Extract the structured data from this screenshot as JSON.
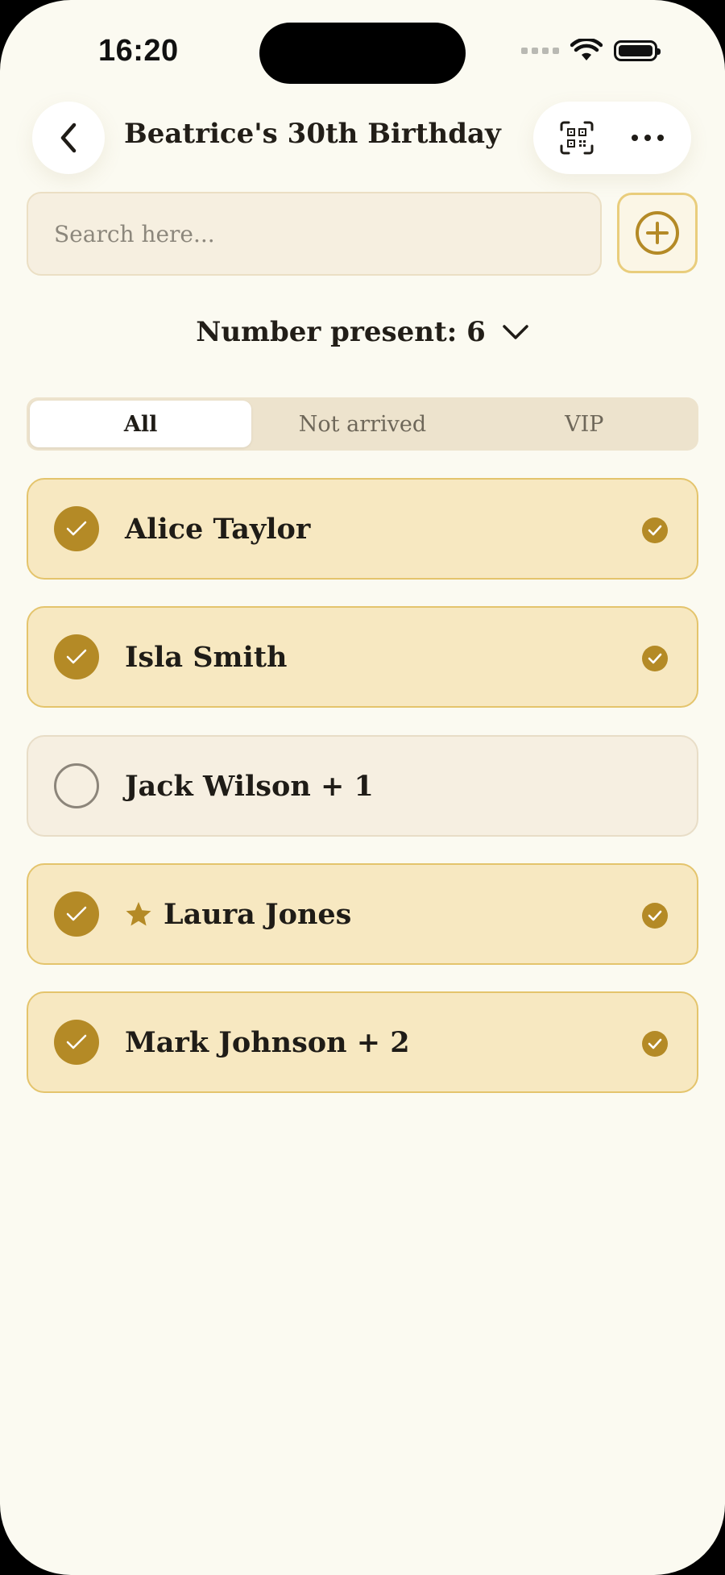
{
  "status_bar": {
    "time": "16:20"
  },
  "header": {
    "title": "Beatrice's 30th Birthday",
    "back_icon": "chevron-left-icon",
    "qr_icon": "qr-scan-icon",
    "more_icon": "more-horizontal-icon"
  },
  "search": {
    "placeholder": "Search here...",
    "value": ""
  },
  "add_button_icon": "plus-circle-icon",
  "present": {
    "label": "Number present: 6",
    "icon": "chevron-down-icon"
  },
  "tabs": [
    {
      "label": "All",
      "active": true
    },
    {
      "label": "Not arrived",
      "active": false
    },
    {
      "label": "VIP",
      "active": false
    }
  ],
  "guests": [
    {
      "name": "Alice Taylor",
      "checked_in": true,
      "vip": false
    },
    {
      "name": "Isla Smith",
      "checked_in": true,
      "vip": false
    },
    {
      "name": "Jack Wilson + 1",
      "checked_in": false,
      "vip": false
    },
    {
      "name": "Laura Jones",
      "checked_in": true,
      "vip": true
    },
    {
      "name": "Mark Johnson + 2",
      "checked_in": true,
      "vip": false
    }
  ],
  "colors": {
    "background": "#fbfaf1",
    "accent": "#b48a26",
    "checked_card": "#f7e8c1",
    "unchecked_card": "#f6efe1"
  }
}
